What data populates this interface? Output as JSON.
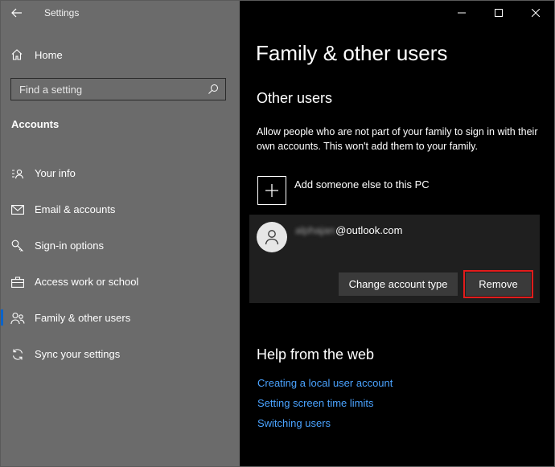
{
  "app": {
    "title": "Settings"
  },
  "sidebar": {
    "home_label": "Home",
    "search_placeholder": "Find a setting",
    "section_label": "Accounts",
    "items": [
      {
        "label": "Your info",
        "icon": "person-card-icon"
      },
      {
        "label": "Email & accounts",
        "icon": "mail-icon"
      },
      {
        "label": "Sign-in options",
        "icon": "key-icon"
      },
      {
        "label": "Access work or school",
        "icon": "briefcase-icon"
      },
      {
        "label": "Family & other users",
        "icon": "people-icon",
        "active": true
      },
      {
        "label": "Sync your settings",
        "icon": "sync-icon"
      }
    ]
  },
  "main": {
    "title": "Family & other users",
    "other_users": {
      "heading": "Other users",
      "description": "Allow people who are not part of your family to sign in with their own accounts. This won't add them to your family.",
      "add_label": "Add someone else to this PC",
      "user": {
        "email_redacted": "alphajan",
        "email_domain": "@outlook.com",
        "change_button": "Change account type",
        "remove_button": "Remove"
      }
    },
    "help": {
      "heading": "Help from the web",
      "links": [
        "Creating a local user account",
        "Setting screen time limits",
        "Switching users"
      ]
    }
  },
  "colors": {
    "sidebar_bg": "#6b6b6b",
    "main_bg": "#000000",
    "link": "#4aa3ff",
    "highlight": "#e21b1b",
    "accent": "#0a63c9"
  }
}
